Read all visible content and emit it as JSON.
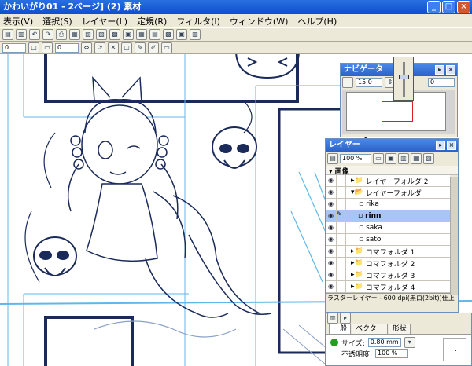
{
  "window": {
    "title": "かわいがり01 - 2ページ] (2) 素材"
  },
  "menu": [
    "表示(V)",
    "選択(S)",
    "レイヤー(L)",
    "定規(R)",
    "フィルタ(I)",
    "ウィンドウ(W)",
    "ヘルプ(H)"
  ],
  "toolbar2": {
    "field1": "0",
    "field2": "0"
  },
  "navigator": {
    "title": "ナビゲータ",
    "zoom": "15.0",
    "rotate": "0"
  },
  "layers": {
    "title": "レイヤー",
    "opacity": "100 %",
    "group": "画像",
    "items": [
      {
        "name": "レイヤーフォルダ 2",
        "kind": "folder",
        "selected": false
      },
      {
        "name": "レイヤーフォルダ",
        "kind": "folder",
        "selected": false
      },
      {
        "name": "rika",
        "kind": "layer",
        "selected": false
      },
      {
        "name": "rinn",
        "kind": "layer",
        "selected": true
      },
      {
        "name": "saka",
        "kind": "layer",
        "selected": false
      },
      {
        "name": "sato",
        "kind": "layer",
        "selected": false
      },
      {
        "name": "コマフォルダ 1",
        "kind": "folder",
        "selected": false
      },
      {
        "name": "コマフォルダ 2",
        "kind": "folder",
        "selected": false
      },
      {
        "name": "コマフォルダ 3",
        "kind": "folder",
        "selected": false
      },
      {
        "name": "コマフォルダ 4",
        "kind": "folder",
        "selected": false
      }
    ],
    "status": "ラスターレイヤー - 600 dpi(黒白(2bit))仕上"
  },
  "props": {
    "tabs": [
      "一般",
      "ベクター",
      "形状"
    ],
    "size_label": "サイズ:",
    "size_value": "0.80 mm",
    "opacity_label": "不透明度:",
    "opacity_value": "100 %"
  },
  "colors": {
    "accent": "#2b62c8",
    "selected": "#a8c4f8",
    "lineart": "#1a2a5a",
    "guide": "#5fb8e8"
  }
}
